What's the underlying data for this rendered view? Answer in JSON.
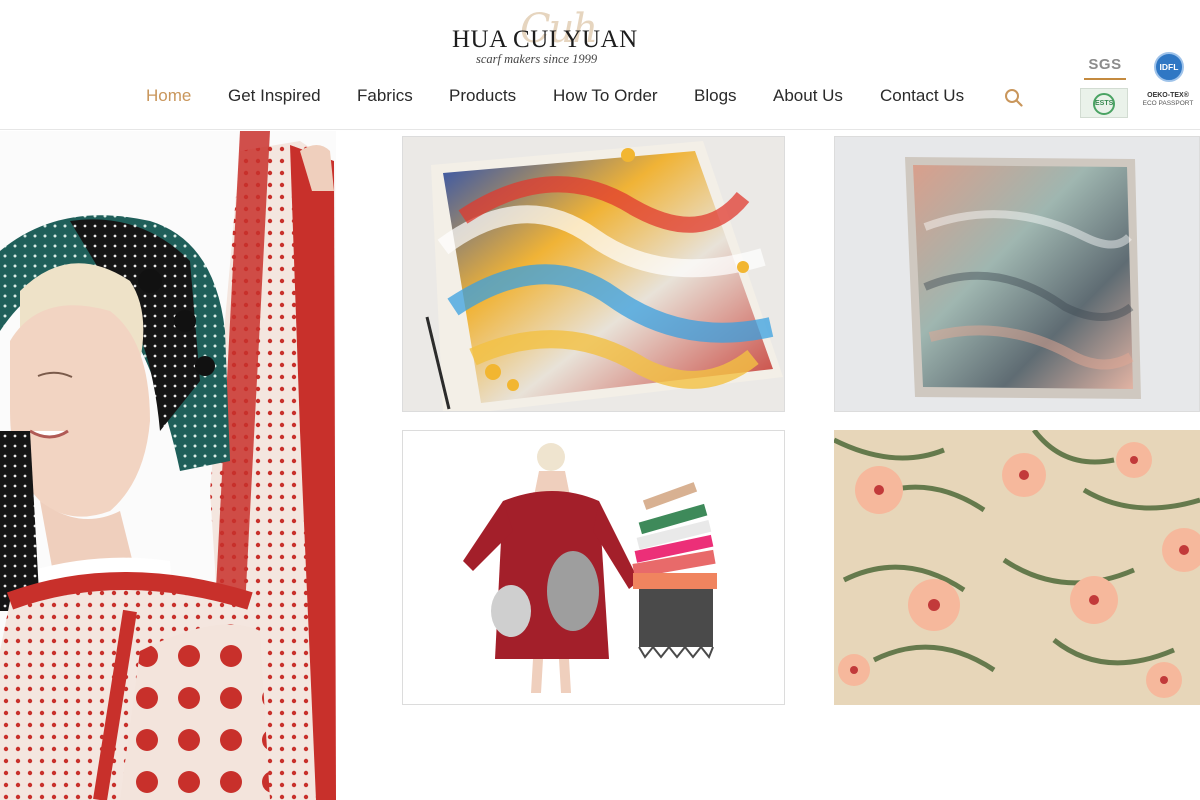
{
  "brand": {
    "name": "HUA CUI YUAN",
    "tagline": "scarf makers since 1999"
  },
  "nav": {
    "items": [
      {
        "label": "Home",
        "active": true
      },
      {
        "label": "Get Inspired",
        "active": false
      },
      {
        "label": "Fabrics",
        "active": false
      },
      {
        "label": "Products",
        "active": false
      },
      {
        "label": "How To Order",
        "active": false
      },
      {
        "label": "Blogs",
        "active": false
      },
      {
        "label": "About Us",
        "active": false
      },
      {
        "label": "Contact Us",
        "active": false
      }
    ],
    "search_icon": "search-icon"
  },
  "certifications": {
    "sgs": "SGS",
    "idfl": "IDFL",
    "ests": "ESTS",
    "oeko_line1": "OEKO-TEX®",
    "oeko_line2": "ECO PASSPORT"
  },
  "images": {
    "hero": "woman-with-red-polka-dot-silk-scarf",
    "tile_1": "colorful-swirl-silk-scarf",
    "tile_2": "muted-watercolor-wrinkled-scarf",
    "tile_3": "model-in-red-printed-wrap-and-stacked-scarves",
    "tile_4": "hibiscus-palm-print-fabric"
  },
  "colors": {
    "accent": "#c9965b",
    "nav_text": "#2a2a2a",
    "scarf_red": "#c8302b"
  }
}
